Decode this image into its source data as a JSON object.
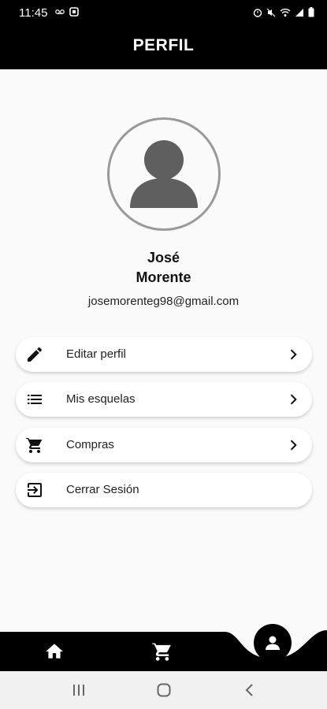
{
  "status_bar": {
    "time": "11:45",
    "left_icons": [
      "voicemail-icon",
      "notification-icon"
    ],
    "right_icons": [
      "alarm-icon",
      "mute-icon",
      "wifi-icon",
      "signal-icon",
      "battery-icon"
    ]
  },
  "app_bar": {
    "title": "PERFIL"
  },
  "profile": {
    "first_name": "José",
    "last_name": "Morente",
    "email": "josemorenteg98@gmail.com"
  },
  "menu": [
    {
      "label": "Editar perfil",
      "icon": "pencil-icon",
      "chevron": true
    },
    {
      "label": "Mis esquelas",
      "icon": "list-icon",
      "chevron": true
    },
    {
      "label": "Compras",
      "icon": "cart-icon",
      "chevron": true
    },
    {
      "label": "Cerrar Sesión",
      "icon": "logout-icon",
      "chevron": false
    }
  ],
  "bottom_nav": {
    "items": [
      "home-icon",
      "cart-icon",
      "profile-icon"
    ],
    "active": "profile-icon"
  },
  "system_nav": [
    "recents-icon",
    "home-circle-icon",
    "back-icon"
  ],
  "colors": {
    "bar": "#000000",
    "background": "#fafafa",
    "avatar_gray": "#5f5f5f"
  }
}
